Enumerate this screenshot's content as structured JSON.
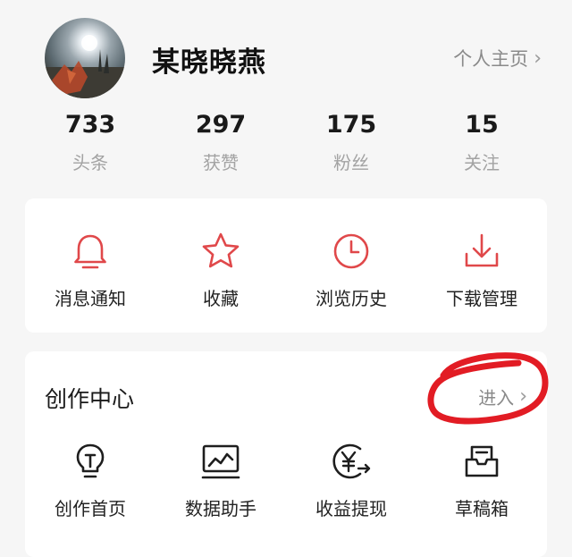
{
  "header": {
    "username": "某晓晓燕",
    "profile_link": "个人主页",
    "avatar_icon": "avatar-photo"
  },
  "stats": [
    {
      "value": "733",
      "label": "头条"
    },
    {
      "value": "297",
      "label": "获赞"
    },
    {
      "value": "175",
      "label": "粉丝"
    },
    {
      "value": "15",
      "label": "关注"
    }
  ],
  "quick_actions": [
    {
      "label": "消息通知",
      "icon": "bell-icon"
    },
    {
      "label": "收藏",
      "icon": "star-icon"
    },
    {
      "label": "浏览历史",
      "icon": "clock-icon"
    },
    {
      "label": "下载管理",
      "icon": "download-icon"
    }
  ],
  "creator_center": {
    "title": "创作中心",
    "enter_link": "进入",
    "items": [
      {
        "label": "创作首页",
        "icon": "lightbulb-icon"
      },
      {
        "label": "数据助手",
        "icon": "chart-monitor-icon"
      },
      {
        "label": "收益提现",
        "icon": "yen-coin-icon"
      },
      {
        "label": "草稿箱",
        "icon": "drafts-box-icon"
      }
    ]
  },
  "colors": {
    "accent_icon": "#e0484a",
    "annotation_circle": "#e21c24"
  }
}
